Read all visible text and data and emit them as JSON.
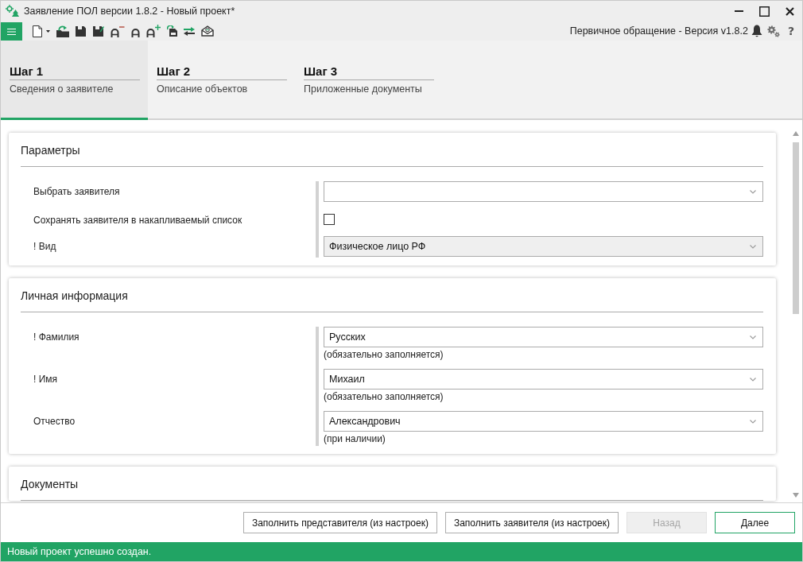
{
  "window": {
    "title": "Заявление ПОЛ версии 1.8.2 - Новый проект*"
  },
  "toolbar": {
    "mode_label": "Первичное обращение - Версия v1.8.2",
    "help": "?"
  },
  "steps": [
    {
      "title": "Шаг 1",
      "subtitle": "Сведения о заявителе",
      "selected": true
    },
    {
      "title": "Шаг 2",
      "subtitle": "Описание объектов",
      "selected": false
    },
    {
      "title": "Шаг 3",
      "subtitle": "Приложенные документы",
      "selected": false
    }
  ],
  "sections": [
    {
      "title": "Параметры",
      "fields": [
        {
          "kind": "combo",
          "label": "Выбрать заявителя"
        },
        {
          "kind": "checkbox",
          "label": "Сохранять заявителя в накапливаемый список",
          "checked": false
        },
        {
          "kind": "select",
          "label": "! Вид",
          "value": "Физическое лицо РФ"
        }
      ]
    },
    {
      "title": "Личная информация",
      "fields": [
        {
          "kind": "combo",
          "label": "! Фамилия",
          "value": "Русских",
          "hint": "(обязательно заполняется)"
        },
        {
          "kind": "combo",
          "label": "! Имя",
          "value": "Михаил",
          "hint": "(обязательно заполняется)"
        },
        {
          "kind": "combo",
          "label": "Отчество",
          "value": "Александрович",
          "hint": "(при наличии)"
        }
      ]
    },
    {
      "title": "Документы"
    }
  ],
  "buttons": [
    {
      "label": "Заполнить представителя (из настроек)",
      "kind": "default",
      "disabled": false
    },
    {
      "label": "Заполнить заявителя (из настроек)",
      "kind": "default",
      "disabled": false
    },
    {
      "label": "Назад",
      "kind": "nav",
      "disabled": true
    },
    {
      "label": "Далее",
      "kind": "primary",
      "disabled": false
    }
  ],
  "status_bar": {
    "text": "Новый проект успешно создан."
  }
}
